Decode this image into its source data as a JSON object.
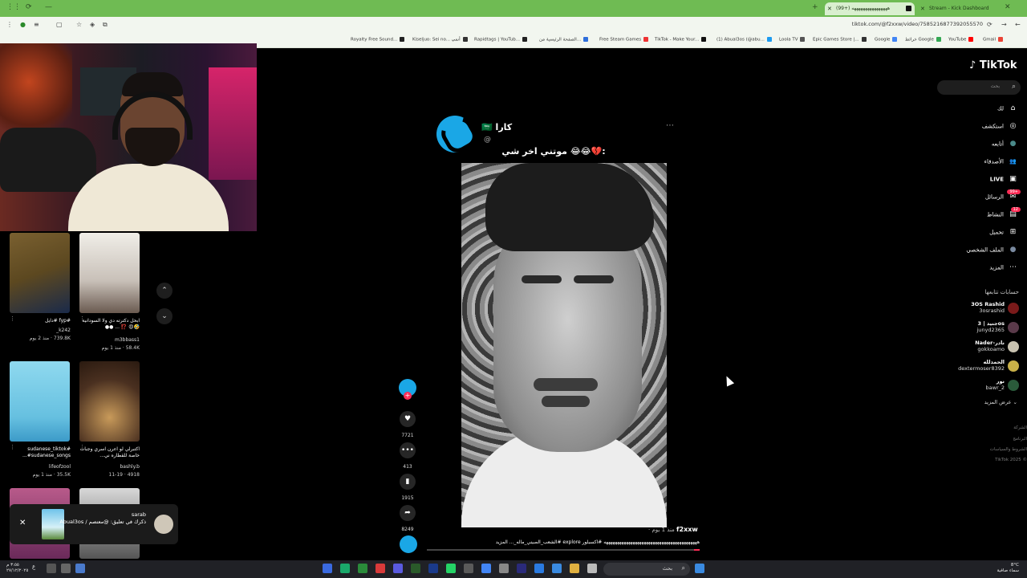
{
  "browser": {
    "tabs": [
      {
        "label": "(99+) ‫ههههههههههههههههه"
      },
      {
        "label": "Stream - Kick Dashboard"
      }
    ],
    "url": "tiktok.com/@f2xxw/video/7585216877392055570",
    "bookmarks": [
      {
        "label": "Royalty Free Sound...",
        "color": "#222"
      },
      {
        "label": "Kiseljuo: Sei no... أنمي",
        "color": "#333"
      },
      {
        "label": "Rapidtags | YouTub...",
        "color": "#222"
      },
      {
        "label": "الصفحة الرئيسية من...",
        "color": "#2f6fdb"
      },
      {
        "label": "Free Steam Games",
        "color": "#e33"
      },
      {
        "label": "TikTok - Make Your...",
        "color": "#111"
      },
      {
        "label": "(1) Abual3os (@abu...",
        "color": "#1d9bf0"
      },
      {
        "label": "Loola TV",
        "color": "#555"
      },
      {
        "label": "Epic Games Store |...",
        "color": "#333"
      },
      {
        "label": "Google",
        "color": "#4285f4"
      },
      {
        "label": "خرائط Google",
        "color": "#34a853"
      },
      {
        "label": "YouTube",
        "color": "#f00"
      },
      {
        "label": "Gmail",
        "color": "#ea4335"
      }
    ]
  },
  "suggestions": [
    {
      "caption": "#fyp #دايل",
      "author": "k242_",
      "meta": "739.8K · منذ 2 يوم",
      "colors": [
        "#6a5224",
        "#1a2a4a"
      ]
    },
    {
      "caption": "ابحل دكترته دي ولا السودانية 🤣😍 ⁉️ ... ●●",
      "author": "m3bbass1",
      "meta": "58.4K · منذ 1 يوم",
      "colors": [
        "#e8e6e0",
        "#5b5048"
      ]
    },
    {
      "caption": "#sudanese_tiktok #sudanese_songs...",
      "author": "lifeofzool",
      "meta": "35.5K · منذ 1 يوم",
      "colors": [
        "#8fd9ef",
        "#3c9ac8"
      ]
    },
    {
      "caption": "اكتبرلي لو اعرن اسري وجبات خاصة للقطاره ني...",
      "author": "bashly.b",
      "meta": "4918 · 11-19",
      "colors": [
        "#4a3020",
        "#c89a5a"
      ]
    }
  ],
  "notification": {
    "title": "sarab",
    "text": "ذكرك في تعليق: @معتصم / Abual3os"
  },
  "post": {
    "username": "كارا",
    "flag": "🇸🇦",
    "handle": "@",
    "caption": "موتني اخر شي 😂😂💔:",
    "counts": {
      "likes": "7721",
      "comments": "413",
      "saves": "1915",
      "shares": "8249"
    },
    "author": "f2xxw",
    "time": "منذ 1 يوم ·",
    "description": "ههههههههههههههههههههههههههههههههههههههههههه #اكسبلور explore #الشعب_الصيني_ماله_... المزيد",
    "progress": 0.02
  },
  "sidebar": {
    "logo": "TikTok",
    "search_placeholder": "بحث",
    "nav": [
      {
        "label": "لك",
        "icon": "⌂"
      },
      {
        "label": "استكشف",
        "icon": "◎"
      },
      {
        "label": "أتابعه",
        "icon": "●"
      },
      {
        "label": "الأصدقاء",
        "icon": "👥"
      },
      {
        "label": "LIVE",
        "icon": "▣"
      },
      {
        "label": "الرسائل",
        "icon": "✉",
        "badge": "99+"
      },
      {
        "label": "النشاط",
        "icon": "▤",
        "badge": "12"
      },
      {
        "label": "تحميل",
        "icon": "⊞"
      },
      {
        "label": "الملف الشخصي",
        "icon": "●"
      },
      {
        "label": "المزيد",
        "icon": "⋯"
      }
    ],
    "following_title": "حسابات تتابعها",
    "following": [
      {
        "name": "3OS Rashid",
        "handle": "3osrashid",
        "color": "#7a1a1a"
      },
      {
        "name": "جنيد | 3os",
        "handle": "junyd2365",
        "color": "#5a3a4a"
      },
      {
        "name": "Nader-نادر",
        "handle": "gokkoamo",
        "color": "#c8c2b0"
      },
      {
        "name": "الحمدلله",
        "handle": "dextermoser8392",
        "color": "#c8b048"
      },
      {
        "name": "نور",
        "handle": "bawr_2",
        "color": "#2a5a3a"
      }
    ],
    "see_more": "عرض المزيد",
    "footer": [
      "الشركة",
      "البرنامج",
      "الشروط والسياسات",
      "TikTok 2025 ©"
    ]
  },
  "taskbar": {
    "search": "بحث",
    "time": "٣:٥٥ م",
    "date": "٢٧/١٢/٢٠٢٥",
    "weather": "8°C",
    "weather_text": "سماء صافية"
  }
}
